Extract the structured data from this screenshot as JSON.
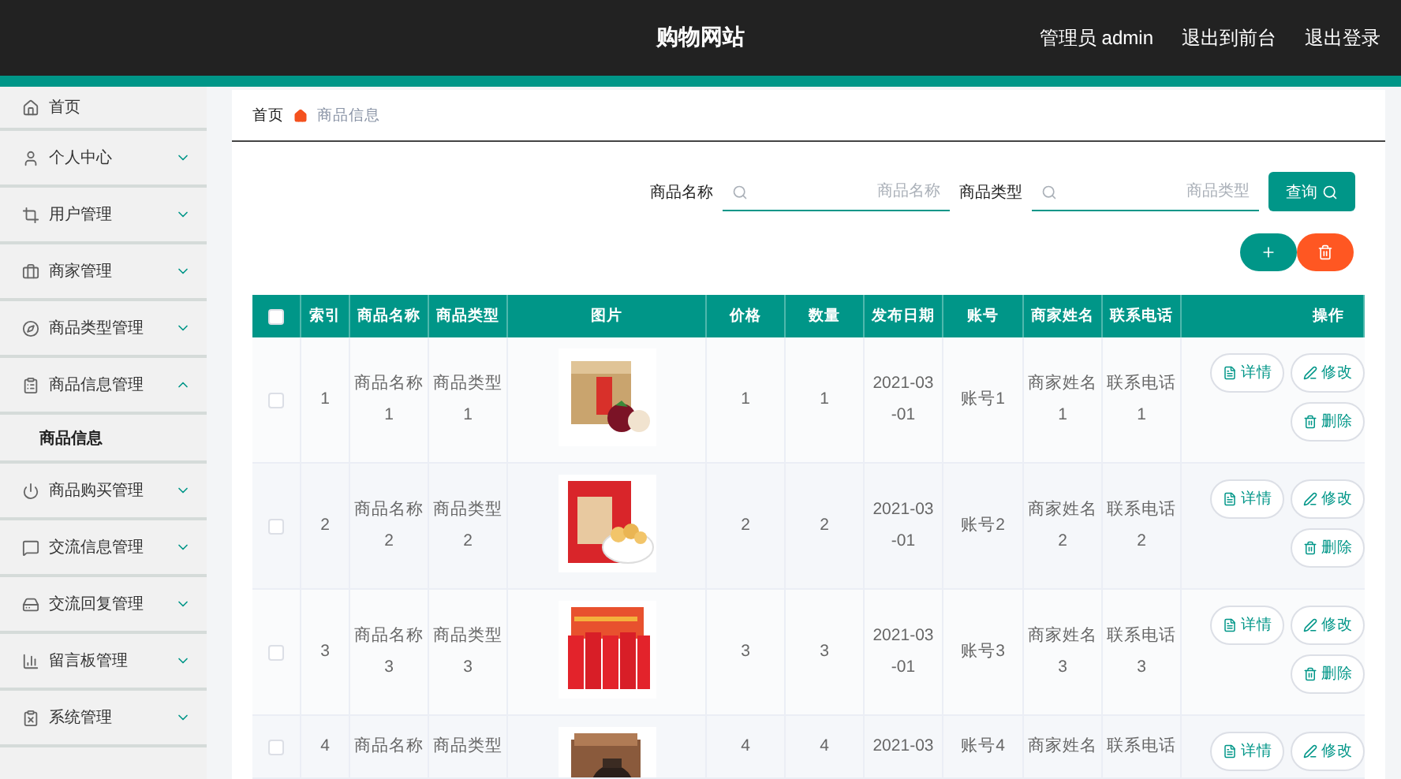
{
  "header": {
    "title": "购物网站",
    "links": [
      "管理员 admin",
      "退出到前台",
      "退出登录"
    ]
  },
  "sidebar": {
    "items": [
      {
        "label": "首页",
        "kind": "link"
      },
      {
        "label": "个人中心",
        "kind": "menu",
        "expanded": false
      },
      {
        "label": "用户管理",
        "kind": "menu",
        "expanded": false
      },
      {
        "label": "商家管理",
        "kind": "menu",
        "expanded": false
      },
      {
        "label": "商品类型管理",
        "kind": "menu",
        "expanded": false
      },
      {
        "label": "商品信息管理",
        "kind": "menu",
        "expanded": true,
        "children": [
          {
            "label": "商品信息",
            "selected": true
          }
        ]
      },
      {
        "label": "商品购买管理",
        "kind": "menu",
        "expanded": false
      },
      {
        "label": "交流信息管理",
        "kind": "menu",
        "expanded": false
      },
      {
        "label": "交流回复管理",
        "kind": "menu",
        "expanded": false
      },
      {
        "label": "留言板管理",
        "kind": "menu",
        "expanded": false
      },
      {
        "label": "系统管理",
        "kind": "menu",
        "expanded": false
      }
    ]
  },
  "breadcrumb": [
    "首页",
    "商品信息"
  ],
  "search": {
    "fields": [
      {
        "label": "商品名称",
        "placeholder": "商品名称"
      },
      {
        "label": "商品类型",
        "placeholder": "商品类型"
      }
    ],
    "button": "查询"
  },
  "table": {
    "select_all": {
      "checked": false
    },
    "columns": [
      "索引",
      "商品名称",
      "商品类型",
      "图片",
      "价格",
      "数量",
      "发布日期",
      "账号",
      "商家姓名",
      "联系电话",
      "操作"
    ],
    "rows": [
      {
        "checked": false,
        "cells": [
          "1",
          "商品名称1",
          "商品类型1",
          {
            "kind": "picture"
          },
          "1",
          "1",
          "2021-03-01",
          "账号1",
          "商家姓名1",
          "联系电话1"
        ],
        "actions": [
          {
            "kind": "detail",
            "label": "详情"
          },
          {
            "kind": "edit",
            "label": "修改"
          },
          {
            "kind": "delete",
            "label": "删除"
          }
        ]
      },
      {
        "checked": false,
        "cells": [
          "2",
          "商品名称2",
          "商品类型2",
          {
            "kind": "picture"
          },
          "2",
          "2",
          "2021-03-01",
          "账号2",
          "商家姓名2",
          "联系电话2"
        ],
        "actions": [
          {
            "kind": "detail",
            "label": "详情"
          },
          {
            "kind": "edit",
            "label": "修改"
          },
          {
            "kind": "delete",
            "label": "删除"
          }
        ]
      },
      {
        "checked": false,
        "cells": [
          "3",
          "商品名称3",
          "商品类型3",
          {
            "kind": "picture"
          },
          "3",
          "3",
          "2021-03-01",
          "账号3",
          "商家姓名3",
          "联系电话3"
        ],
        "actions": [
          {
            "kind": "detail",
            "label": "详情"
          },
          {
            "kind": "edit",
            "label": "修改"
          },
          {
            "kind": "delete",
            "label": "删除"
          }
        ]
      },
      {
        "checked": false,
        "cells": [
          "4",
          "商品名称",
          "商品类型",
          {
            "kind": "picture"
          },
          "4",
          "4",
          "2021-03",
          "账号4",
          "商家姓名",
          "联系电话"
        ],
        "actions": [
          {
            "kind": "detail",
            "label": "详情"
          },
          {
            "kind": "edit",
            "label": "修改"
          }
        ]
      }
    ]
  }
}
